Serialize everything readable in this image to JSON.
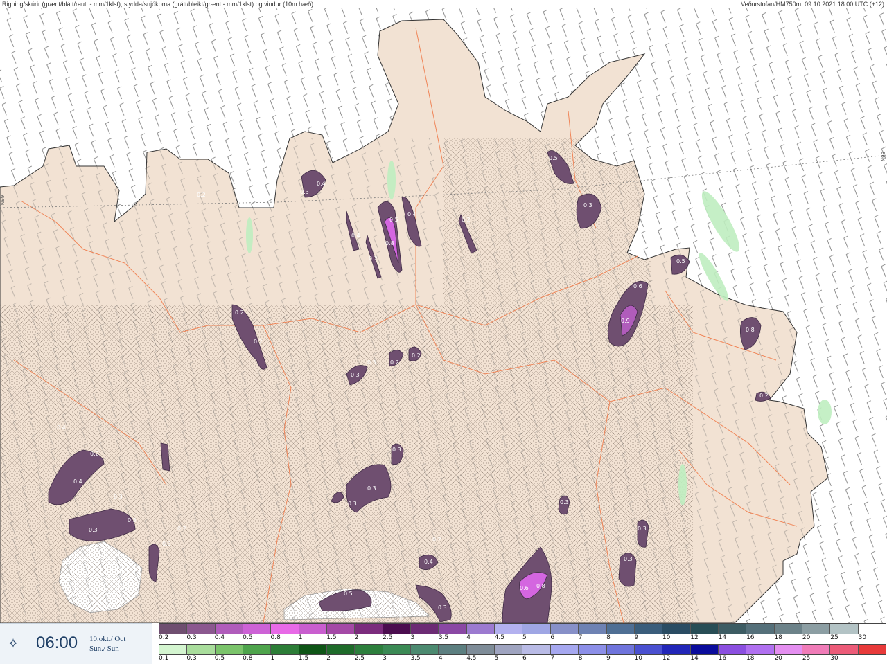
{
  "header": {
    "left": "Rigning/skúrir (grænt/blátt/rautt - mm/1klst), slydda/snjókoma (grátt/bleikt/grænt - mm/1klst) og vindur (10m hæð)",
    "right": "Veðurstofan/HM750m: 09.10.2021 18:00 UTC (+12)"
  },
  "map": {
    "lat_label_left": "N99",
    "lat_label_right": "N99",
    "precip_labels": [
      "0.3",
      "0.4",
      "0.2",
      "0.5",
      "0.5",
      "0.4",
      "0.4",
      "0.8",
      "0.2",
      "0.2",
      "0.3",
      "0.4",
      "0.3",
      "0.5",
      "0.5",
      "0.6",
      "0.9",
      "0.9",
      "0.5",
      "0.6",
      "0.8",
      "0.2",
      "0.2",
      "0.2",
      "0.3",
      "0.3",
      "0.2",
      "0.2",
      "0.3",
      "0.2",
      "0.4",
      "0.4",
      "0.4",
      "0.3",
      "0.3",
      "0.2",
      "0.2",
      "0.3",
      "0.3",
      "0.3",
      "0.3",
      "0.3",
      "0.2",
      "0.4",
      "0.5",
      "0.6",
      "0.8",
      "0.3",
      "0.3",
      "0.3",
      "0.3",
      "0.2",
      "0.3",
      "0.2",
      "0.3"
    ]
  },
  "time_panel": {
    "time": "06:00",
    "date_line1": "10.okt./ Oct",
    "date_line2": "Sun./ Sun",
    "icon": "compass-star-icon"
  },
  "legend": {
    "snow_colors": [
      "#6f4f70",
      "#8b588f",
      "#b05cbb",
      "#cd62d6",
      "#e86ae7",
      "#c95ecf",
      "#a449a6",
      "#7b2c7d",
      "#4b0d4f",
      "#6c2b74",
      "#8a48a4",
      "#9c7ad0",
      "#b3b1ef",
      "#9fa6e4",
      "#8790c8",
      "#6e82b3",
      "#4f6f94",
      "#3a5d7b",
      "#2a4c63",
      "#284d55",
      "#3d5c63",
      "#55707a",
      "#6c8289",
      "#8c9ea3",
      "#b3c3c5",
      "#ffffff"
    ],
    "snow_ticks": [
      "0.2",
      "0.3",
      "0.4",
      "0.5",
      "0.8",
      "1",
      "1.5",
      "2",
      "2.5",
      "3",
      "3.5",
      "4",
      "4.5",
      "5",
      "6",
      "7",
      "8",
      "9",
      "10",
      "12",
      "14",
      "16",
      "18",
      "20",
      "25",
      "30"
    ],
    "rain_colors": [
      "#d4f5d0",
      "#a9dd9c",
      "#7bc46b",
      "#4ea44c",
      "#2c7d37",
      "#0e5516",
      "#1e6b2a",
      "#2d7f3d",
      "#3b8a55",
      "#4c8a70",
      "#5c7f80",
      "#7e8c98",
      "#9fa4c0",
      "#b9bbe6",
      "#a6a8f0",
      "#8c8fe8",
      "#6f74dc",
      "#4a50d0",
      "#2226b8",
      "#0a0c9c",
      "#8b4fe0",
      "#b070f0",
      "#e48ff0",
      "#f07cb8",
      "#ec5b78",
      "#e83a3a"
    ],
    "rain_ticks": [
      "0.1",
      "0.3",
      "0.5",
      "0.8",
      "1",
      "1.5",
      "2",
      "2.5",
      "3",
      "3.5",
      "4",
      "4.5",
      "5",
      "6",
      "7",
      "8",
      "9",
      "10",
      "12",
      "14",
      "16",
      "18",
      "20",
      "25",
      "30"
    ]
  }
}
